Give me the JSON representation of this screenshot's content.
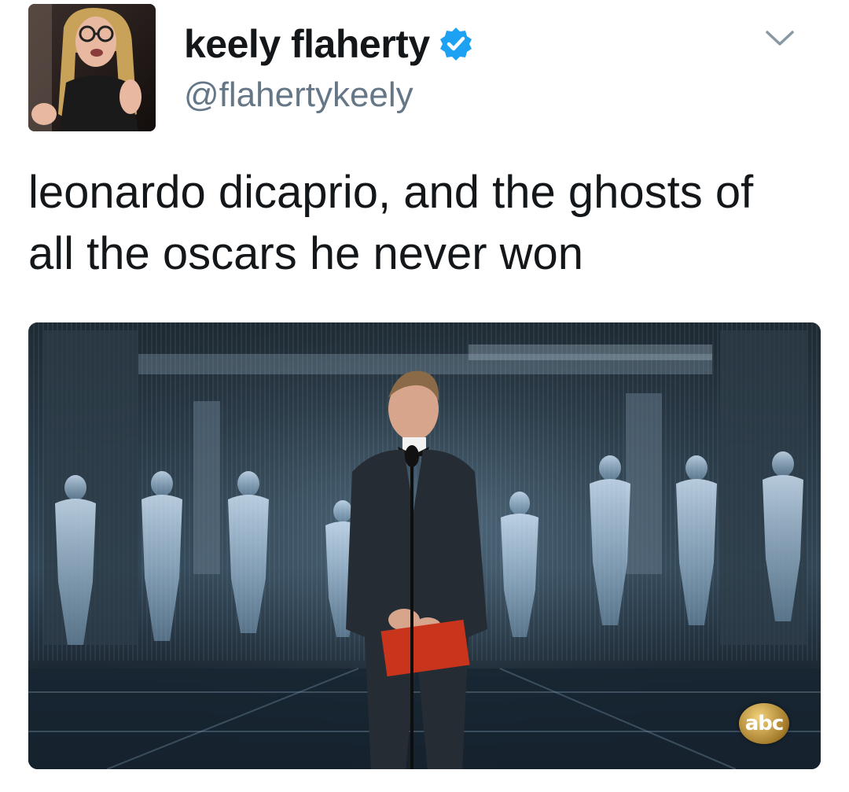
{
  "tweet": {
    "author": {
      "display_name": "keely flaherty",
      "handle": "@flahertykeely",
      "verified": true,
      "avatar_icon": "profile-photo"
    },
    "menu_icon": "chevron-down-icon",
    "text_lines": [
      "leonardo dicaprio, and the ghosts of",
      "all the oscars he never won"
    ],
    "media": {
      "type": "photo",
      "watermark": "abc"
    }
  },
  "colors": {
    "text_primary": "#14171a",
    "text_secondary": "#657786",
    "verified_blue": "#1da1f2",
    "caret_gray": "#8899a6",
    "envelope_red": "#c9341c"
  }
}
